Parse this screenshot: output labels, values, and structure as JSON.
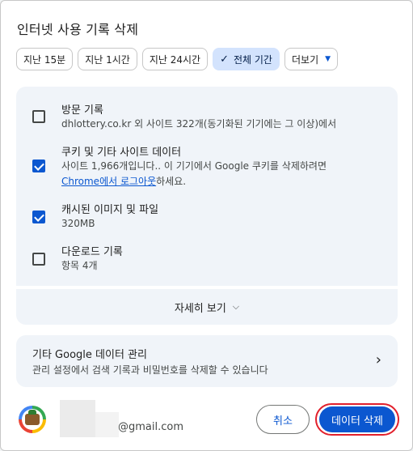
{
  "title": "인터넷 사용 기록 삭제",
  "time_chips": [
    {
      "label": "지난 15분",
      "selected": false
    },
    {
      "label": "지난 1시간",
      "selected": false
    },
    {
      "label": "지난 24시간",
      "selected": false
    },
    {
      "label": "전체 기간",
      "selected": true
    },
    {
      "label": "더보기",
      "dropdown": true
    }
  ],
  "items": [
    {
      "title": "방문 기록",
      "subtitle": "dhlottery.co.kr 외 사이트 322개(동기화된 기기에는 그 이상)에서",
      "checked": false
    },
    {
      "title": "쿠키 및 기타 사이트 데이터",
      "subtitle_line1": "사이트 1,966개입니다.. 이 기기에서 Google 쿠키를 삭제하려면",
      "subtitle_link": "Chrome에서 로그아웃",
      "subtitle_line2_rest": "하세요.",
      "checked": true
    },
    {
      "title": "캐시된 이미지 및 파일",
      "subtitle": "320MB",
      "checked": true
    },
    {
      "title": "다운로드 기록",
      "subtitle": "항목 4개",
      "checked": false
    }
  ],
  "more_details": "자세히 보기",
  "google_data": {
    "title": "기타 Google 데이터 관리",
    "subtitle": "관리 설정에서 검색 기록과 비밀번호를 삭제할 수 있습니다"
  },
  "account": {
    "email": "@gmail.com"
  },
  "buttons": {
    "cancel": "취소",
    "delete": "데이터 삭제"
  },
  "colors": {
    "accent": "#0b57d0",
    "panel": "#f0f4f9",
    "highlight_ring": "#e2202c"
  }
}
